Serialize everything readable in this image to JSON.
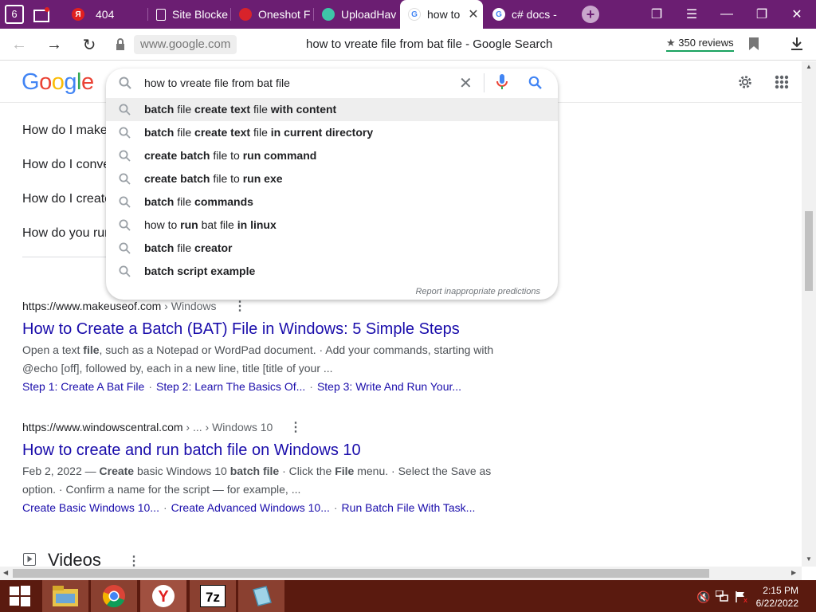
{
  "browser": {
    "tabs": [
      {
        "label": "404",
        "icon": "yandex-icon"
      },
      {
        "label": "Site Blocke",
        "icon": "document-icon"
      },
      {
        "label": "Oneshot F",
        "icon": "oneshot-icon"
      },
      {
        "label": "UploadHav",
        "icon": "cloud-icon"
      },
      {
        "label": "how to",
        "icon": "google-icon"
      },
      {
        "label": "c# docs -",
        "icon": "google-icon"
      }
    ],
    "url": "www.google.com",
    "page_title": "how to vreate file from bat file - Google Search",
    "reviews": "350 reviews"
  },
  "google": {
    "logo": "Google",
    "query": "how to vreate file from bat file",
    "suggestions": [
      [
        {
          "t": "batch",
          "b": true
        },
        {
          "t": " file ",
          "b": false
        },
        {
          "t": "create text",
          "b": true
        },
        {
          "t": " file ",
          "b": false
        },
        {
          "t": "with content",
          "b": true
        }
      ],
      [
        {
          "t": "batch",
          "b": true
        },
        {
          "t": " file ",
          "b": false
        },
        {
          "t": "create text",
          "b": true
        },
        {
          "t": " file ",
          "b": false
        },
        {
          "t": "in current directory",
          "b": true
        }
      ],
      [
        {
          "t": "create batch",
          "b": true
        },
        {
          "t": " file to ",
          "b": false
        },
        {
          "t": "run command",
          "b": true
        }
      ],
      [
        {
          "t": "create batch",
          "b": true
        },
        {
          "t": " file to ",
          "b": false
        },
        {
          "t": "run exe",
          "b": true
        }
      ],
      [
        {
          "t": "batch",
          "b": true
        },
        {
          "t": " file ",
          "b": false
        },
        {
          "t": "commands",
          "b": true
        }
      ],
      [
        {
          "t": "how to ",
          "b": false
        },
        {
          "t": "run",
          "b": true
        },
        {
          "t": " bat file ",
          "b": false
        },
        {
          "t": "in linux",
          "b": true
        }
      ],
      [
        {
          "t": "batch",
          "b": true
        },
        {
          "t": " file ",
          "b": false
        },
        {
          "t": "creator",
          "b": true
        }
      ],
      [
        {
          "t": "batch script example",
          "b": true
        }
      ]
    ],
    "report": "Report inappropriate predictions"
  },
  "paa": [
    "How do I make",
    "How do I conve",
    "How do I create",
    "How do you rur"
  ],
  "results": [
    {
      "cite_host": "https://www.makeuseof.com",
      "cite_path": " › Windows",
      "title": "How to Create a Batch (BAT) File in Windows: 5 Simple Steps",
      "snippet": [
        {
          "t": "Open a text ",
          "b": false
        },
        {
          "t": "file",
          "b": true
        },
        {
          "t": ", such as a Notepad or WordPad document. · Add your commands, starting with @echo [off], followed by, each in a new line, title [title of your ...",
          "b": false
        }
      ],
      "sitelinks": [
        "Step 1: Create A Bat File",
        "Step 2: Learn The Basics Of...",
        "Step 3: Write And Run Your..."
      ]
    },
    {
      "cite_host": "https://www.windowscentral.com",
      "cite_path": " › ... › Windows 10",
      "title": "How to create and run batch file on Windows 10",
      "snippet": [
        {
          "t": "Feb 2, 2022 — ",
          "b": false
        },
        {
          "t": "Create",
          "b": true
        },
        {
          "t": " basic Windows 10 ",
          "b": false
        },
        {
          "t": "batch file",
          "b": true
        },
        {
          "t": " · Click the ",
          "b": false
        },
        {
          "t": "File",
          "b": true
        },
        {
          "t": " menu. · Select the Save as option. · Confirm a name for the script — for example, ...",
          "b": false
        }
      ],
      "sitelinks": [
        "Create Basic Windows 10...",
        "Create Advanced Windows 10...",
        "Run Batch File With Task..."
      ]
    }
  ],
  "videos_label": "Videos",
  "taskbar": {
    "apps": [
      "file-explorer",
      "chrome",
      "yandex",
      "7zip",
      "notepad"
    ],
    "time": "2:15 PM",
    "date": "6/22/2022"
  },
  "colors": {
    "tabbar": "#6b1e72",
    "taskbar": "#5a1a0f",
    "link": "#1a0dab"
  }
}
